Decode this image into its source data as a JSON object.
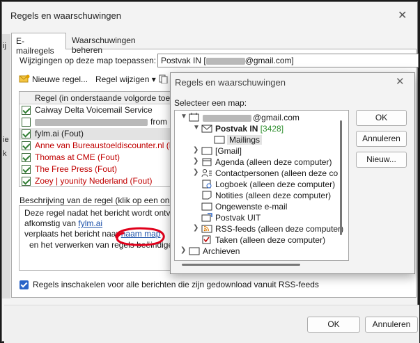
{
  "main": {
    "title": "Regels en waarschuwingen",
    "tabs": [
      {
        "label": "E-mailregels"
      },
      {
        "label": "Waarschuwingen beheren"
      }
    ],
    "apply_label": "Wijzigingen op deze map toepassen:",
    "folder_value_prefix": "Postvak IN [",
    "folder_value_suffix": "@gmail.com]",
    "toolbar": {
      "new_rule": "Nieuwe regel...",
      "edit_rule": "Regel wijzigen",
      "edit_rule_arrow": "▾"
    },
    "rules_header": "Regel (in onderstaande volgorde toeg",
    "rules": [
      {
        "name": "Caiway Delta Voicemail Service",
        "checked": true,
        "error": false
      },
      {
        "name": "from C",
        "checked": false,
        "error": false
      },
      {
        "name": "fylm.ai  (Fout)",
        "checked": true,
        "error": false
      },
      {
        "name": "Anne van Bureaustoeldiscounter.nl  (F",
        "checked": true,
        "error": true
      },
      {
        "name": "Thomas at CME  (Fout)",
        "checked": true,
        "error": true
      },
      {
        "name": "The Free Press  (Fout)",
        "checked": true,
        "error": true
      },
      {
        "name": "Zoey | younity Nederland  (Fout)",
        "checked": true,
        "error": true
      }
    ],
    "description_label": "Beschrijving van de regel (klik op een onde",
    "description": {
      "line1": "Deze regel nadat het bericht wordt ontva",
      "line2_prefix": "afkomstig van ",
      "line2_link": "fylm.ai",
      "line3_prefix": "verplaats het bericht naar ",
      "line3_link": "naam map",
      "line4": "en het verwerken van regels beëindiger"
    },
    "rss_checkbox_label": "Regels inschakelen voor alle berichten die zijn gedownload vanuit RSS-feeds",
    "ok_label": "OK",
    "cancel_label": "Annuleren",
    "left_strip": [
      "ij",
      "ie",
      "k"
    ]
  },
  "picker": {
    "title": "Regels en waarschuwingen",
    "select_label": "Selecteer een map:",
    "account_suffix": "@gmail.com",
    "folders": [
      {
        "label": "Postvak IN",
        "count": "[3428]",
        "bold": true
      },
      {
        "label": "Mailings"
      },
      {
        "label": "[Gmail]"
      },
      {
        "label": "Agenda (alleen deze computer)"
      },
      {
        "label": "Contactpersonen (alleen deze co"
      },
      {
        "label": "Logboek (alleen deze computer)"
      },
      {
        "label": "Notities (alleen deze computer)"
      },
      {
        "label": "Ongewenste e-mail"
      },
      {
        "label": "Postvak UIT"
      },
      {
        "label": "RSS-feeds (alleen deze computer)"
      },
      {
        "label": "Taken (alleen deze computer)"
      },
      {
        "label": "Archieven"
      }
    ],
    "ok_label": "OK",
    "cancel_label": "Annuleren",
    "new_label": "Nieuw..."
  }
}
